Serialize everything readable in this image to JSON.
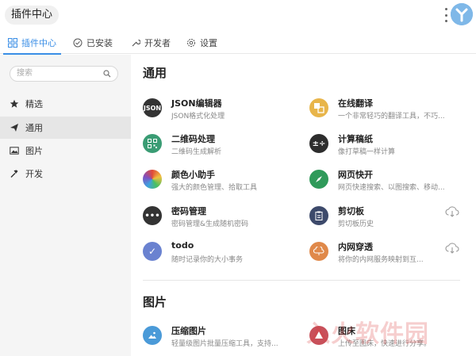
{
  "header": {
    "title": "插件中心"
  },
  "tabs": [
    {
      "label": "插件中心",
      "active": true
    },
    {
      "label": "已安装",
      "active": false
    },
    {
      "label": "开发者",
      "active": false
    },
    {
      "label": "设置",
      "active": false
    }
  ],
  "sidebar": {
    "search_placeholder": "搜索",
    "items": [
      {
        "label": "精选",
        "icon": "star-icon",
        "active": false
      },
      {
        "label": "通用",
        "icon": "paper-plane-icon",
        "active": true
      },
      {
        "label": "图片",
        "icon": "image-icon",
        "active": false
      },
      {
        "label": "开发",
        "icon": "hammer-icon",
        "active": false
      }
    ]
  },
  "sections": [
    {
      "title": "通用",
      "plugins": [
        {
          "name": "JSON编辑器",
          "desc": "JSON格式化处理",
          "icon": "json-icon",
          "icon_text": "JSON",
          "color": "#333333",
          "downloadable": false
        },
        {
          "name": "在线翻译",
          "desc": "一个非常轻巧的翻译工具，不巧...",
          "icon": "translate-icon",
          "icon_text": "",
          "color": "#e8b54a",
          "downloadable": false
        },
        {
          "name": "二维码处理",
          "desc": "二维码生成解析",
          "icon": "qrcode-icon",
          "icon_text": "",
          "color": "#3a9c74",
          "downloadable": false
        },
        {
          "name": "计算稿纸",
          "desc": "像打草稿一样计算",
          "icon": "calculator-icon",
          "icon_text": "",
          "color": "#2d2d2d",
          "downloadable": false
        },
        {
          "name": "颜色小助手",
          "desc": "强大的颜色管理、拾取工具",
          "icon": "color-wheel-icon",
          "icon_text": "",
          "color": "#e04a3a",
          "downloadable": false
        },
        {
          "name": "网页快开",
          "desc": "网页快速搜索、以图搜索、移动...",
          "icon": "compass-icon",
          "icon_text": "",
          "color": "#2f9a5a",
          "downloadable": false
        },
        {
          "name": "密码管理",
          "desc": "密码管理&生成随机密码",
          "icon": "password-icon",
          "icon_text": "•••",
          "color": "#333333",
          "downloadable": false
        },
        {
          "name": "剪切板",
          "desc": "剪切板历史",
          "icon": "clipboard-icon",
          "icon_text": "",
          "color": "#3d4a6b",
          "downloadable": true
        },
        {
          "name": "todo",
          "desc": "随时记录你的大小事务",
          "icon": "check-icon",
          "icon_text": "✓",
          "color": "#6a82d0",
          "downloadable": false
        },
        {
          "name": "内网穿透",
          "desc": "将你的内网服务映射到互...",
          "icon": "tunnel-icon",
          "icon_text": "",
          "color": "#e0894a",
          "downloadable": true
        }
      ]
    },
    {
      "title": "图片",
      "plugins": [
        {
          "name": "压缩图片",
          "desc": "轻量级图片批量压缩工具，支持...",
          "icon": "compress-image-icon",
          "icon_text": "",
          "color": "#4a9ad8",
          "downloadable": false
        },
        {
          "name": "图床",
          "desc": "上传至图床，快速进行分享。",
          "icon": "image-host-icon",
          "icon_text": "",
          "color": "#c8505a",
          "downloadable": false
        }
      ]
    }
  ],
  "watermark": "入火软件园"
}
